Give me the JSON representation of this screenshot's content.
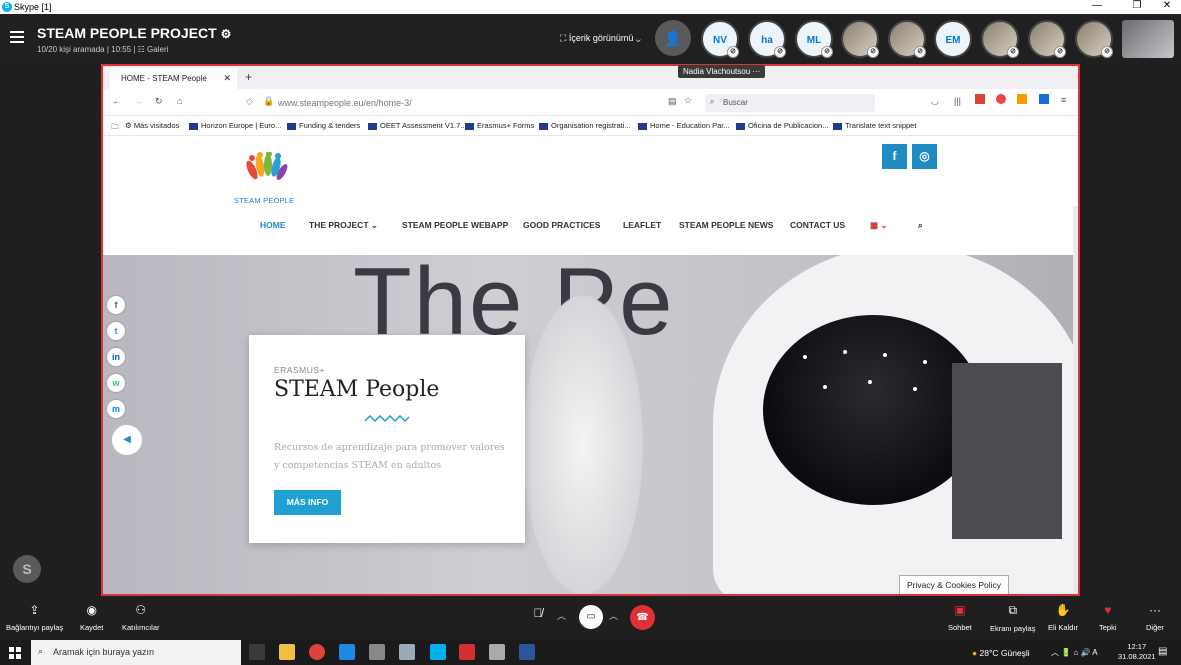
{
  "window": {
    "title": "Skype [1]",
    "controls": [
      "—",
      "❐",
      "✕"
    ]
  },
  "call": {
    "project_title": "STEAM PEOPLE PROJECT",
    "status": "10/20 kişi aramada | 10:55 | ☷ Galeri",
    "content_view_label": "İçerik görünümü",
    "tooltip": "Nadia Vlachoutsou  ···",
    "participants": [
      {
        "initials": "NV"
      },
      {
        "initials": "ha"
      },
      {
        "initials": "ML"
      },
      {
        "initials": ""
      },
      {
        "initials": ""
      },
      {
        "initials": "EM"
      },
      {
        "initials": ""
      },
      {
        "initials": ""
      },
      {
        "initials": ""
      }
    ]
  },
  "browser": {
    "tab_title": "HOME - STEAM People",
    "new_tab": "+",
    "url": "www.steampeople.eu/en/home-3/",
    "search_placeholder": "Buscar",
    "bookmarks": [
      "Más visitados",
      "Horizon Europe | Euro...",
      "Funding & tenders",
      "OEET Assessment V1.7...",
      "Erasmus+ Forms",
      "Organisation registrati...",
      "Home - Education Par...",
      "Oficina de Publicacion...",
      "Translate text snippet"
    ]
  },
  "site": {
    "logo_text": "STEAM PEOPLE",
    "nav": [
      "HOME",
      "THE PROJECT ⌄",
      "STEAM PEOPLE WEBAPP",
      "GOOD PRACTICES",
      "LEAFLET",
      "STEAM PEOPLE NEWS",
      "CONTACT US"
    ],
    "social_top": [
      "f",
      "◎"
    ],
    "hero_text": "The Pe",
    "card": {
      "kicker": "ERASMUS+",
      "title": "STEAM People",
      "description": "Recursos de aprendizaje para promover valores y competencias STEAM en adultos",
      "button": "MÁS INFO"
    },
    "share_icons": [
      "f",
      "t",
      "in",
      "w",
      "m"
    ],
    "privacy": "Privacy & Cookies Policy"
  },
  "controls": {
    "left": [
      "Bağlantıyı paylaş",
      "Kaydet",
      "Katılımcılar"
    ],
    "right": [
      "Sohbet",
      "Ekranı paylaş",
      "Eli Kaldır",
      "Tepki",
      "Diğer"
    ]
  },
  "taskbar": {
    "search_placeholder": "Aramak için buraya yazın",
    "weather": "28°C  Güneşli",
    "time": "12:17",
    "date": "31.08.2021"
  }
}
